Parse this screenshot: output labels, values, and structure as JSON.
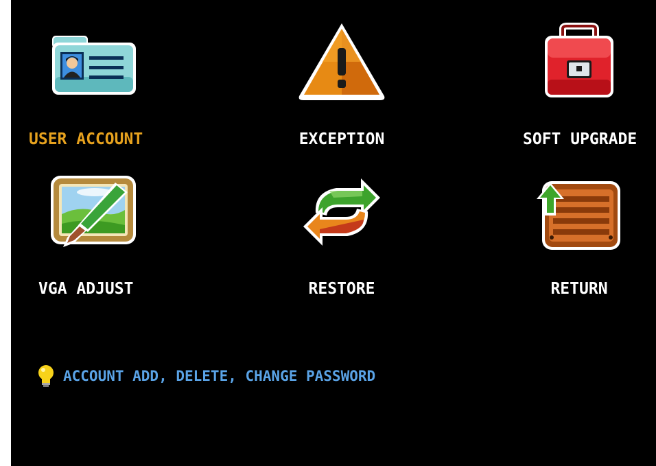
{
  "menu": {
    "items": [
      {
        "id": "user_account",
        "label": "USER ACCOUNT",
        "icon": "user-card-icon",
        "selected": true
      },
      {
        "id": "exception",
        "label": "EXCEPTION",
        "icon": "warning-icon",
        "selected": false
      },
      {
        "id": "soft_upgrade",
        "label": "SOFT UPGRADE",
        "icon": "toolbox-icon",
        "selected": false
      },
      {
        "id": "vga_adjust",
        "label": "VGA ADJUST",
        "icon": "paint-brush-picture-icon",
        "selected": false
      },
      {
        "id": "restore",
        "label": "RESTORE",
        "icon": "restore-arrows-icon",
        "selected": false
      },
      {
        "id": "return",
        "label": "RETURN",
        "icon": "return-box-icon",
        "selected": false
      }
    ]
  },
  "hint": {
    "icon": "lightbulb-icon",
    "text": "ACCOUNT  ADD, DELETE, CHANGE  PASSWORD"
  },
  "colors": {
    "background": "#000000",
    "selected_label": "#e7a21e",
    "label": "#ffffff",
    "hint_text": "#5aa3e6"
  }
}
